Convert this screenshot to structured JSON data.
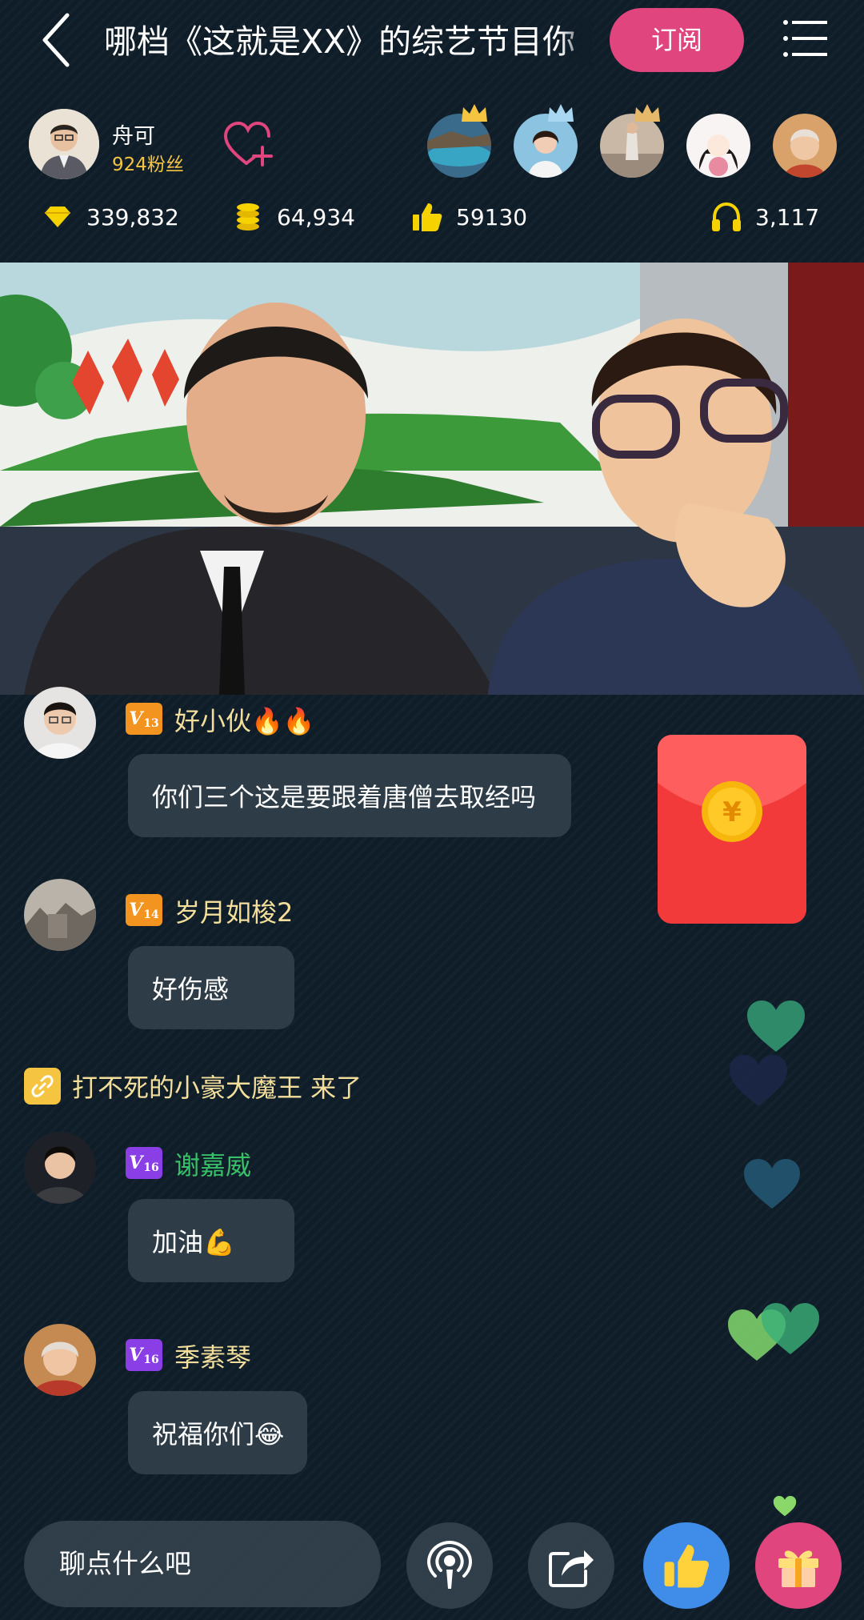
{
  "header": {
    "title": "哪档《这就是XX》的综艺节目你",
    "subscribe_label": "订阅"
  },
  "host": {
    "name": "舟可",
    "fans": "924粉丝"
  },
  "stats": {
    "diamonds": "339,832",
    "coins": "64,934",
    "likes": "59130",
    "listeners": "3,117"
  },
  "chat": {
    "messages": [
      {
        "level": "13",
        "name": "好小伙🔥🔥",
        "text": "你们三个这是要跟着唐僧去取经吗"
      },
      {
        "level": "14",
        "name": "岁月如梭2",
        "text": "好伤感"
      },
      {
        "level": "16",
        "name": "谢嘉威",
        "text": "加油💪"
      },
      {
        "level": "16",
        "name": "季素琴",
        "text": "祝福你们😂"
      }
    ],
    "system": "打不死的小豪大魔王 来了"
  },
  "vip_prefix": "V",
  "input": {
    "placeholder": "聊点什么吧"
  },
  "colors": {
    "accent": "#e0457e",
    "gold": "#f5c542",
    "username": "#f3df9b",
    "special_username": "#38c068",
    "background": "#0f1d29"
  },
  "icons": [
    "back-icon",
    "menu-icon",
    "heart-plus-icon",
    "diamond-icon",
    "coins-icon",
    "thumbs-up-icon",
    "headphones-icon",
    "crown-icon",
    "link-icon",
    "red-packet-icon",
    "podcast-icon",
    "share-icon",
    "gift-icon",
    "heart-icon"
  ]
}
